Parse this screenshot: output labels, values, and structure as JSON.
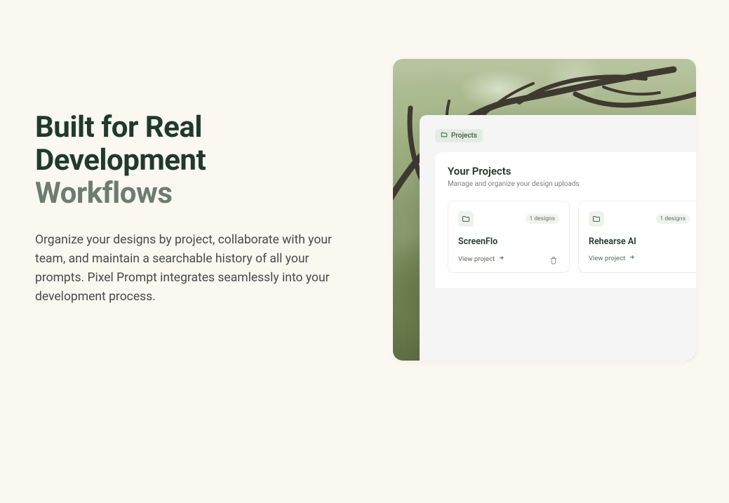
{
  "hero": {
    "title_line1": "Built for Real",
    "title_line2": "Development",
    "title_accent": "Workflows",
    "subtext": "Organize your designs by project, collaborate with your team, and maintain a searchable history of all your prompts. Pixel Prompt integrates seamlessly into your development process."
  },
  "preview": {
    "breadcrumb_label": "Projects",
    "panel_title": "Your Projects",
    "panel_subtitle": "Manage and organize your design uploads",
    "cards": [
      {
        "title": "ScreenFlo",
        "designs_chip": "1 designs",
        "view_label": "View project",
        "has_trash": true
      },
      {
        "title": "Rehearse AI",
        "designs_chip": "1 designs",
        "view_label": "View project",
        "has_trash": false
      }
    ]
  }
}
